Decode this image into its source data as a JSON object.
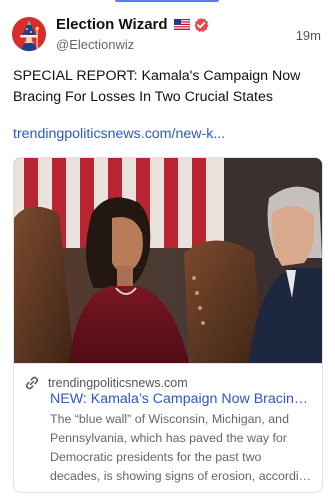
{
  "post": {
    "author": {
      "display_name": "Election Wizard",
      "handle": "@Electionwiz",
      "avatar_icon": "wizard-avatar-icon",
      "avatar_color": "#d92d2d",
      "badges": [
        "us-flag-icon",
        "verified-badge-icon"
      ]
    },
    "timestamp": "19m",
    "text": "SPECIAL REPORT: Kamala's Campaign Now Bracing For Losses In Two Crucial States",
    "link_text": "trendingpoliticsnews.com/new-k...",
    "link_color": "#2f57c4"
  },
  "link_card": {
    "image_icon": "news-photo",
    "domain": "trendingpoliticsnews.com",
    "domain_icon": "link-icon",
    "title": "NEW: Kamala’s Campaign Now Bracing For Losses In Two Crucial States",
    "description": "The “blue wall” of Wisconsin, Michigan, and Pennsylvania, which has paved the way for Democratic presidents for the past two decades, is showing signs of erosion, according to new polling."
  }
}
